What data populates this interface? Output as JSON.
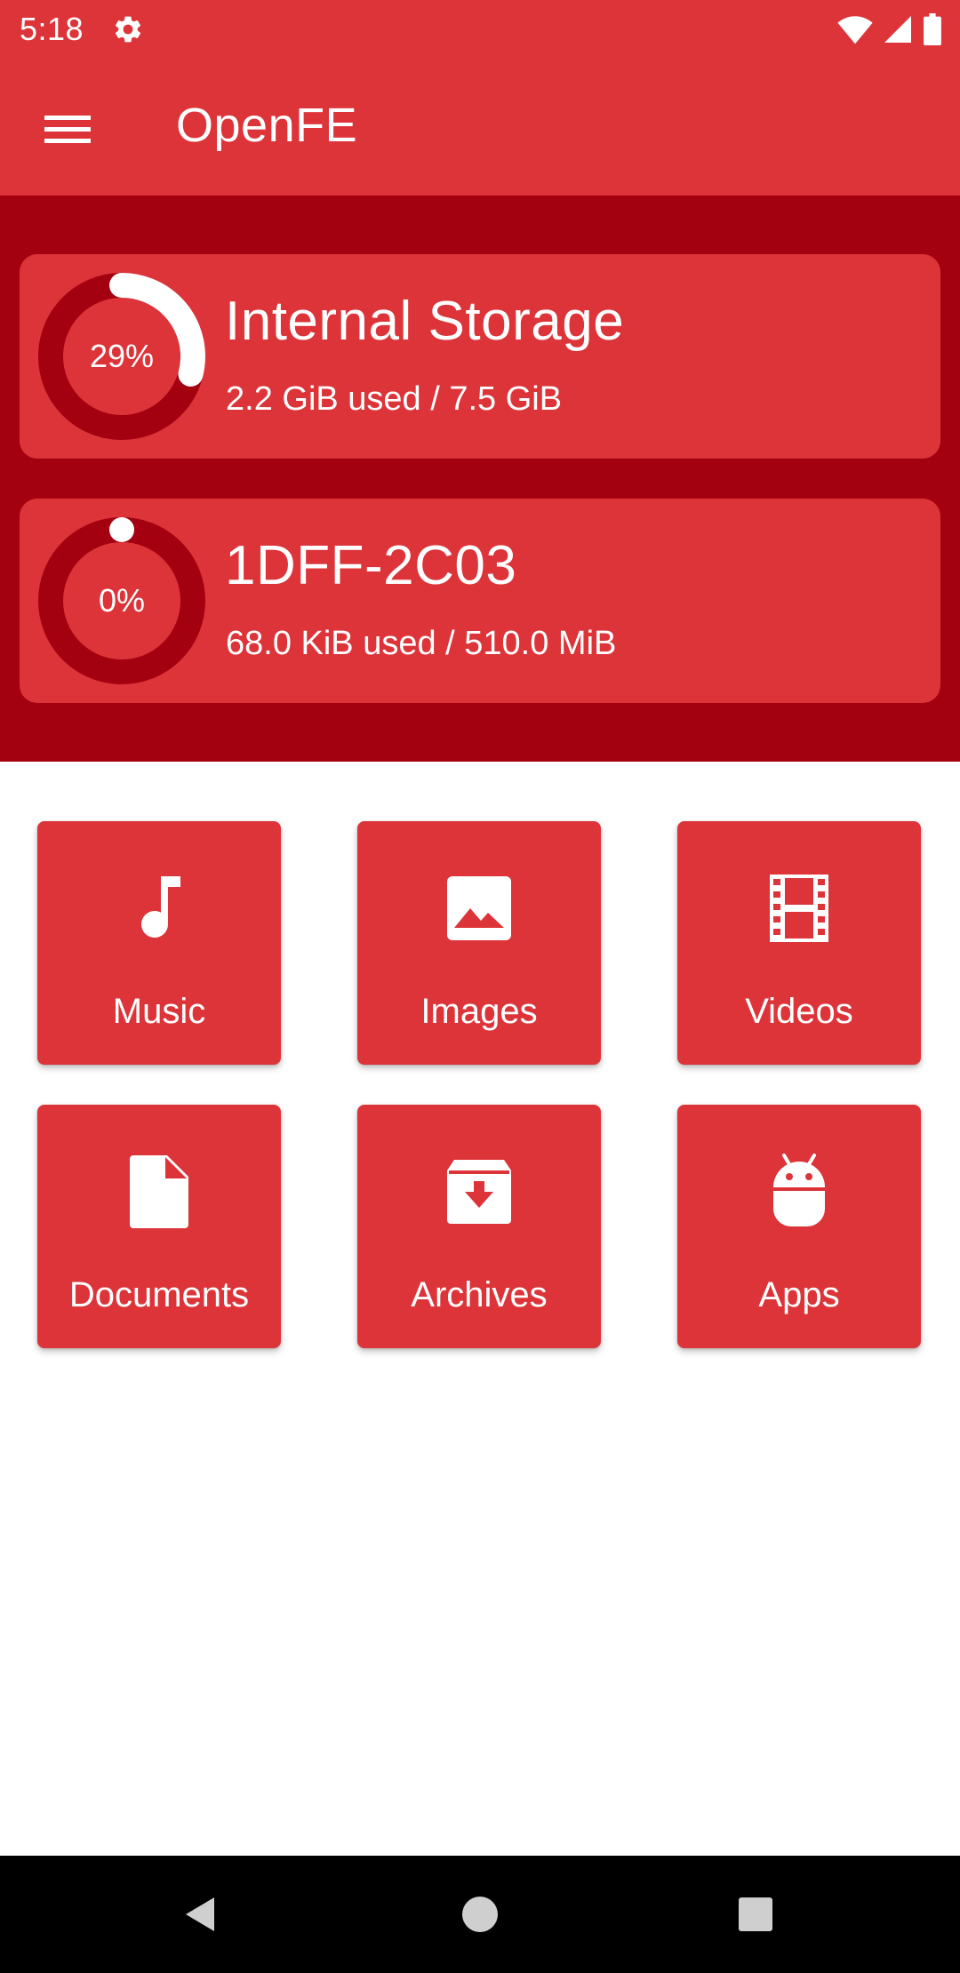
{
  "status_bar": {
    "time": "5:18",
    "icons": [
      "settings-icon",
      "wifi-icon",
      "signal-icon",
      "battery-icon"
    ]
  },
  "app_bar": {
    "title": "OpenFE",
    "menu_icon": "hamburger-menu-icon"
  },
  "storage": [
    {
      "name": "Internal Storage",
      "usage": "2.2 GiB used / 7.5 GiB",
      "percent_label": "29%",
      "percent": 29
    },
    {
      "name": "1DFF-2C03",
      "usage": "68.0 KiB used / 510.0 MiB",
      "percent_label": "0%",
      "percent": 0
    }
  ],
  "categories": [
    {
      "label": "Music",
      "icon": "music-note-icon"
    },
    {
      "label": "Images",
      "icon": "image-icon"
    },
    {
      "label": "Videos",
      "icon": "film-icon"
    },
    {
      "label": "Documents",
      "icon": "document-icon"
    },
    {
      "label": "Archives",
      "icon": "archive-icon"
    },
    {
      "label": "Apps",
      "icon": "android-icon"
    }
  ],
  "nav_bar": {
    "buttons": [
      "back-icon",
      "home-icon",
      "recents-icon"
    ]
  },
  "colors": {
    "primary": "#dc3439",
    "primary_dark": "#a30010",
    "ring_track": "#a30010",
    "text_on_primary": "#ffffff"
  }
}
